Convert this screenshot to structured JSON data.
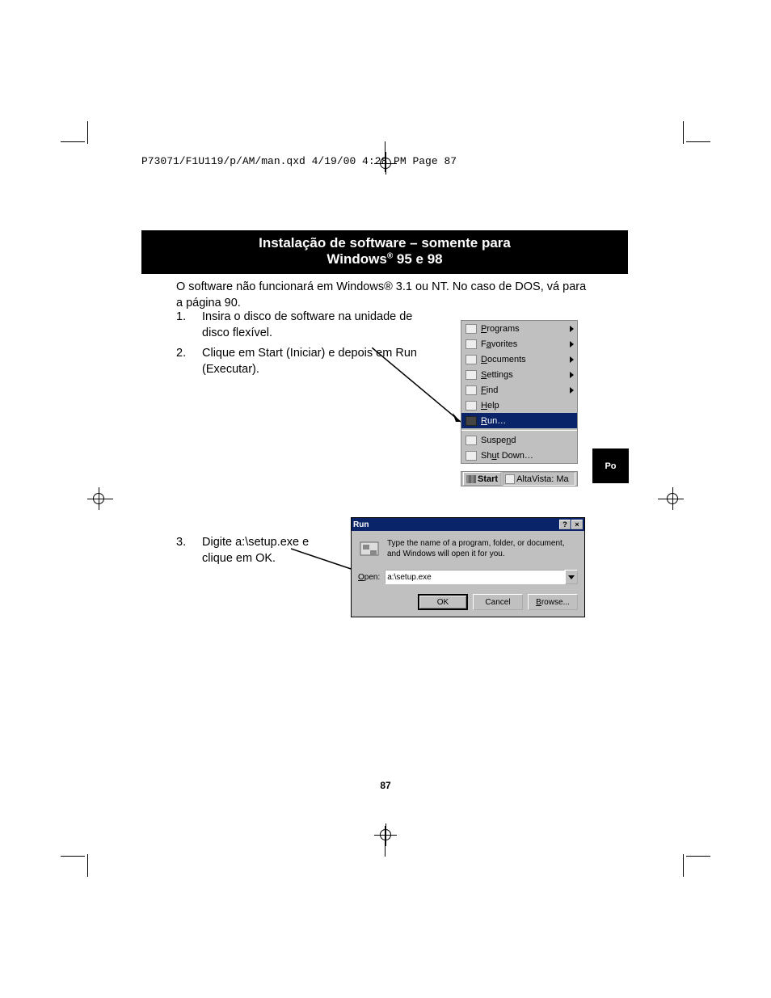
{
  "header_line": "P73071/F1U119/p/AM/man.qxd  4/19/00  4:28 PM  Page 87",
  "title_line1": "Instalação de software – somente para",
  "title_line2_a": "Windows",
  "title_line2_sup": "®",
  "title_line2_b": " 95 e 98",
  "intro": "O software não funcionará em Windows® 3.1 ou NT. No caso de DOS, vá para a página 90.",
  "steps": {
    "s1_num": "1.",
    "s1_txt": "Insira o disco de software na unidade de disco flexível.",
    "s2_num": "2.",
    "s2_txt": "Clique em Start (Iniciar) e depois em Run (Executar).",
    "s3_num": "3.",
    "s3_txt": "Digite a:\\setup.exe e clique em OK."
  },
  "start_menu": {
    "programs": "Programs",
    "favorites": "Favorites",
    "documents": "Documents",
    "settings": "Settings",
    "find": "Find",
    "help": "Help",
    "run": "Run…",
    "suspend": "Suspend",
    "shutdown": "Shut Down…"
  },
  "taskbar": {
    "start": "Start",
    "task1": "AltaVista: Ma"
  },
  "run_dialog": {
    "title": "Run",
    "help_btn": "?",
    "close_btn": "×",
    "desc": "Type the name of a program, folder, or document, and Windows will open it for you.",
    "open_label": "Open:",
    "open_value": "a:\\setup.exe",
    "ok": "OK",
    "cancel": "Cancel",
    "browse": "Browse..."
  },
  "lang_tab": "Po",
  "page_number": "87"
}
